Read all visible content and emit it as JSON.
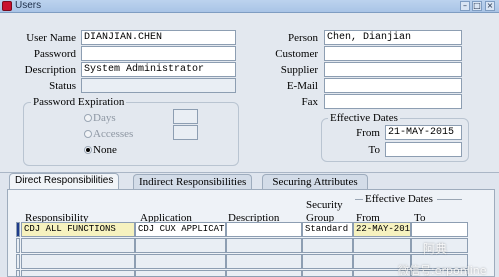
{
  "window": {
    "title": "Users",
    "icon": "oracle-app-icon"
  },
  "left_fields": [
    {
      "label": "User Name",
      "value": "DIANJIAN.CHEN"
    },
    {
      "label": "Password",
      "value": ""
    },
    {
      "label": "Description",
      "value": "System Administrator"
    },
    {
      "label": "Status",
      "value": ""
    }
  ],
  "right_fields": [
    {
      "label": "Person",
      "value": "Chen, Dianjian"
    },
    {
      "label": "Customer",
      "value": ""
    },
    {
      "label": "Supplier",
      "value": ""
    },
    {
      "label": "E-Mail",
      "value": ""
    },
    {
      "label": "Fax",
      "value": ""
    }
  ],
  "password_expiration": {
    "title": "Password Expiration",
    "options": [
      "Days",
      "Accesses",
      "None"
    ],
    "selected": "None"
  },
  "effective_dates": {
    "title": "Effective Dates",
    "from_label": "From",
    "from_value": "21-MAY-2015",
    "to_label": "To",
    "to_value": ""
  },
  "tabs": [
    {
      "label": "Direct Responsibilities",
      "active": true
    },
    {
      "label": "Indirect Responsibilities",
      "active": false
    },
    {
      "label": "Securing Attributes",
      "active": false
    }
  ],
  "grid": {
    "headers": {
      "responsibility": "Responsibility",
      "application": "Application",
      "description": "Description",
      "security_group_1": "Security",
      "security_group_2": "Group",
      "effective_dates": "Effective Dates",
      "from": "From",
      "to": "To"
    },
    "rows": [
      {
        "responsibility": "CDJ ALL FUNCTIONS",
        "application": "CDJ CUX APPLICATION",
        "description": "",
        "security_group": "Standard",
        "from": "22-MAY-2015",
        "to": ""
      }
    ]
  },
  "watermark": {
    "line1": "阿典",
    "line2": "微信号:erponline"
  }
}
